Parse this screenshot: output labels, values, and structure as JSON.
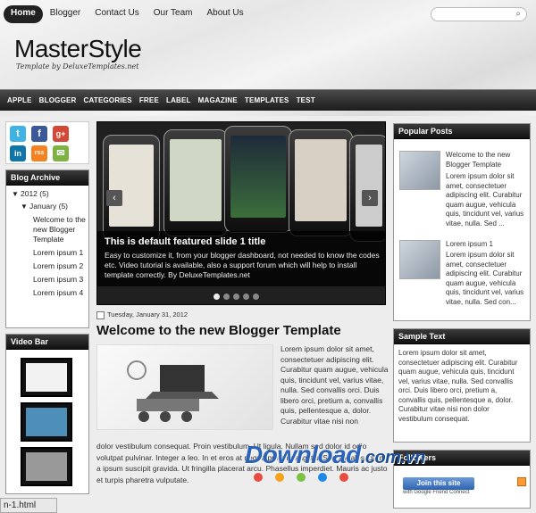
{
  "topnav": [
    "Home",
    "Blogger",
    "Contact Us",
    "Our Team",
    "About Us"
  ],
  "search": {
    "placeholder": ""
  },
  "brand": {
    "title": "MasterStyle",
    "tagline": "Template by DeluxeTemplates.net"
  },
  "catnav": [
    "APPLE",
    "BLOGGER",
    "CATEGORIES",
    "FREE",
    "LABEL",
    "MAGAZINE",
    "TEMPLATES",
    "TEST"
  ],
  "social": [
    "t",
    "f",
    "g+",
    "in",
    "rss",
    "✉"
  ],
  "archive": {
    "title": "Blog Archive",
    "year": "2012",
    "year_count": "(5)",
    "month": "January",
    "month_count": "(5)",
    "posts": [
      "Welcome to the new Blogger Template",
      "Lorem ipsum 1",
      "Lorem ipsum 2",
      "Lorem ipsum 3",
      "Lorem ipsum 4"
    ]
  },
  "videobar": {
    "title": "Video Bar"
  },
  "slider": {
    "title": "This is default featured slide 1 title",
    "desc": "Easy to customize it, from your blogger dashboard, not needed to know the codes etc. Video tutorial is available, also a support forum which will help to install template correctly. By DeluxeTemplates.net",
    "prev": "‹",
    "next": "›"
  },
  "post": {
    "date": "Tuesday, January 31, 2012",
    "title": "Welcome to the new Blogger Template",
    "side_text": "Lorem ipsum dolor sit amet, consectetuer adipiscing elit. Curabitur quam augue, vehicula quis, tincidunt vel, varius vitae, nulla. Sed convallis orci. Duis libero orci, pretium a, convallis quis, pellentesque a, dolor. Curabitur vitae nisi non",
    "bottom_text": "dolor vestibulum consequat. Proin vestibulum. Ut ligula. Nullam sed dolor id odio volutpat pulvinar. Integer a leo. In et eros at neque pretium sagittis. Sed sodales lorem a ipsum suscipit gravida. Ut fringilla placerat arcu. Phasellus imperdiet. Mauris ac justo et turpis pharetra vulputate."
  },
  "popular": {
    "title": "Popular Posts",
    "items": [
      {
        "title": "Welcome to the new Blogger Template",
        "body": "Lorem ipsum dolor sit amet, consectetuer adipiscing elit. Curabitur quam augue, vehicula quis, tincidunt vel, varius vitae, nulla. Sed ..."
      },
      {
        "title": "Lorem ipsum 1",
        "body": "Lorem ipsum dolor sit amet, consectetuer adipiscing elit. Curabitur quam augue, vehicula quis, tincidunt vel, varius vitae, nulla. Sed con..."
      }
    ]
  },
  "sample": {
    "title": "Sample Text",
    "body": "Lorem ipsum dolor sit amet, consectetuer adipiscing elit. Curabitur quam augue, vehicula quis, tincidunt vel, varius vitae, nulla. Sed convallis orci. Duis libero orci, pretium a, convallis quis, pellentesque a, dolor. Curabitur vitae nisi non dolor vestibulum consequat."
  },
  "followers": {
    "title": "Followers",
    "join": "Join this site",
    "gfc": "with Google Friend Connect"
  },
  "watermark": {
    "main": "Download",
    "suffix": ".com.vn"
  },
  "statusbar": "n-1.html"
}
